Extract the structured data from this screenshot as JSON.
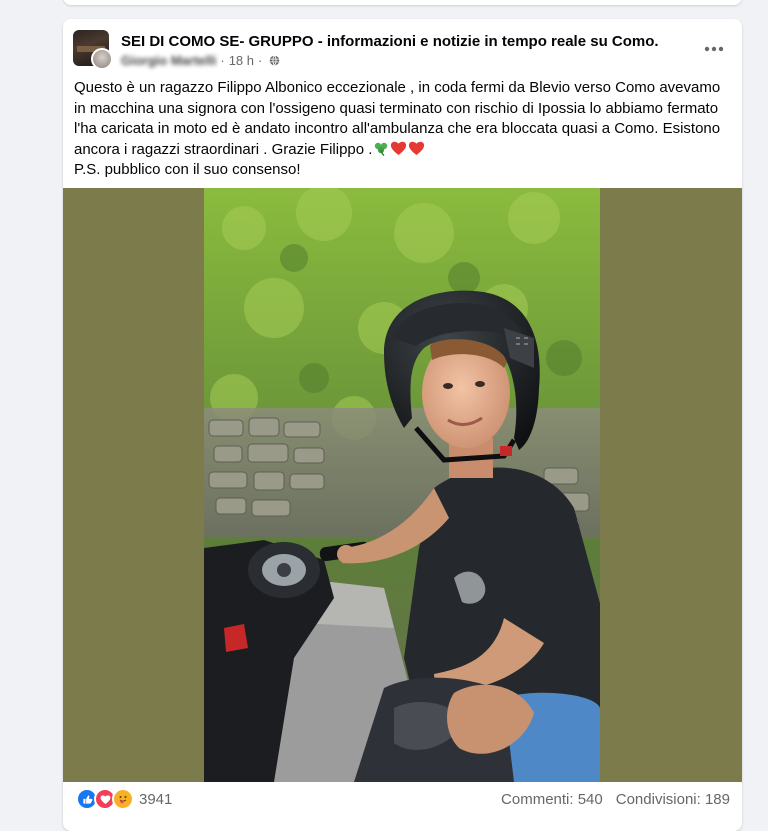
{
  "post": {
    "group_name": "SEI DI COMO SE- GRUPPO - informazioni e notizie in tempo reale su Como.",
    "author": "Giorgio Martelli",
    "time": "18 h",
    "separator": "·",
    "text": {
      "line1": "Questo è un ragazzo  Filippo Albonico eccezionale , in coda fermi da Blevio verso Como avevamo in macchina una signora con l'ossigeno quasi terminato con rischio di Ipossia lo abbiamo fermato l'ha caricata in moto ed è andato incontro all'ambulanza che era bloccata quasi a Como. Esistono ancora i ragazzi straordinari . Grazie Filippo .",
      "line2": "P.S. pubblico con il suo consenso!",
      "emojis": [
        "clover-emoji",
        "red-heart-emoji",
        "red-heart-emoji"
      ]
    },
    "icons": {
      "privacy": "globe-icon",
      "more": "more-horizontal-icon"
    }
  },
  "reactions": {
    "icons": [
      "like-icon",
      "love-icon",
      "care-icon"
    ],
    "count": "3941",
    "comments": "Commenti: 540",
    "shares": "Condivisioni: 189"
  },
  "colors": {
    "media_background": "#7b7b4c",
    "like": "#1877f2",
    "love": "#f33e58",
    "care": "#f7b125",
    "secondary_text": "#65676b"
  }
}
